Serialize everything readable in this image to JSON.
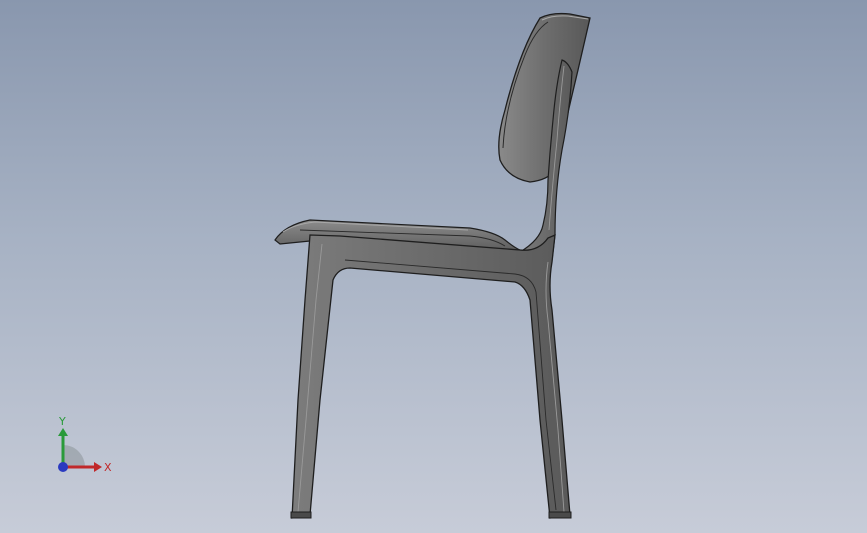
{
  "viewport": {
    "background_top": "#8997ae",
    "background_bottom": "#c7ccd8"
  },
  "model": {
    "part_fill": "#6a6a6a",
    "edge_color": "#1e1e1e",
    "highlight_color": "#9a9a9a"
  },
  "triad": {
    "x_label": "X",
    "y_label": "Y",
    "x_color": "#c0282a",
    "y_color": "#2a9a3a",
    "z_color": "#2a3ac0"
  }
}
